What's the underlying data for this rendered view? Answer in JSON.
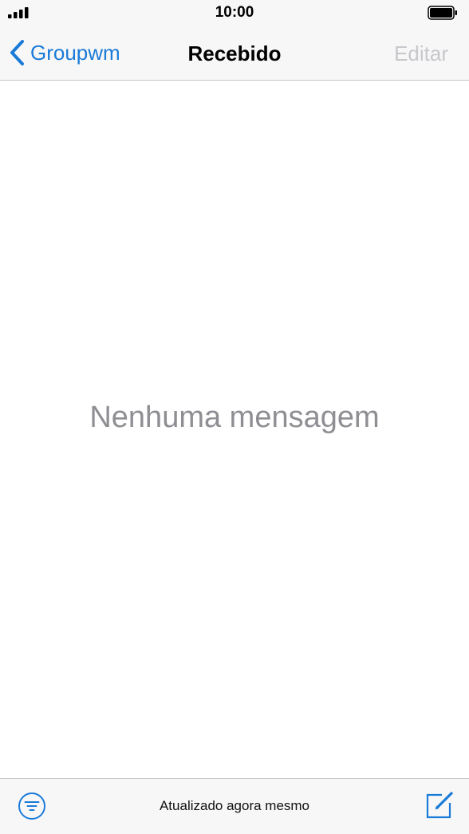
{
  "status_bar": {
    "time": "10:00"
  },
  "nav": {
    "back_label": "Groupwm",
    "title": "Recebido",
    "edit_label": "Editar"
  },
  "main": {
    "empty_message": "Nenhuma mensagem"
  },
  "toolbar": {
    "status_text": "Atualizado agora mesmo"
  },
  "icons": {
    "back": "chevron-left-icon",
    "filter": "filter-icon",
    "compose": "compose-icon"
  },
  "colors": {
    "accent": "#1a7bd8",
    "disabled": "#c7c7cc",
    "placeholder": "#8e8e93"
  }
}
